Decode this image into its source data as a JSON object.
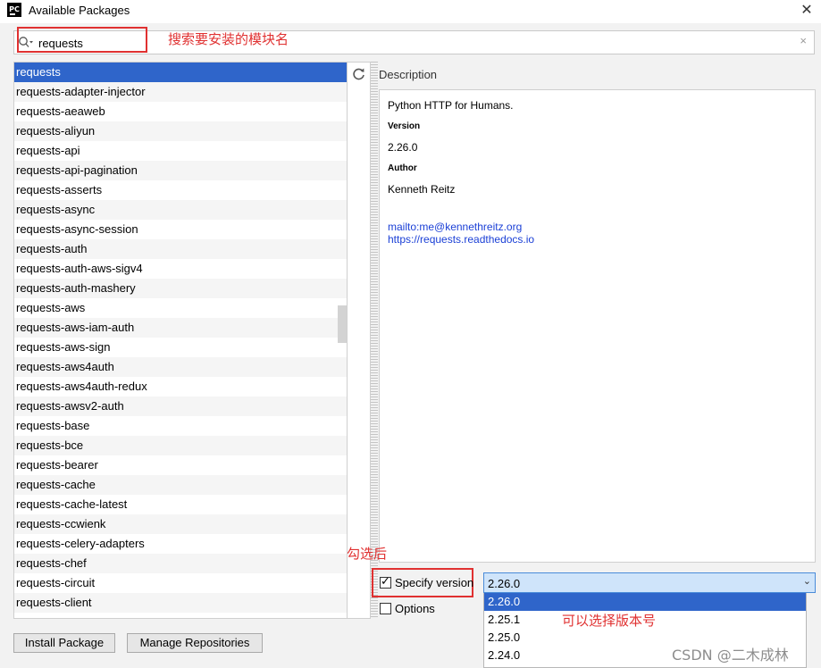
{
  "window": {
    "app_icon_text": "PC",
    "title": "Available Packages",
    "close_glyph": "✕"
  },
  "search": {
    "value": "requests",
    "clear_glyph": "×",
    "annotation": "搜索要安装的模块名"
  },
  "packages": [
    "requests",
    "requests-adapter-injector",
    "requests-aeaweb",
    "requests-aliyun",
    "requests-api",
    "requests-api-pagination",
    "requests-asserts",
    "requests-async",
    "requests-async-session",
    "requests-auth",
    "requests-auth-aws-sigv4",
    "requests-auth-mashery",
    "requests-aws",
    "requests-aws-iam-auth",
    "requests-aws-sign",
    "requests-aws4auth",
    "requests-aws4auth-redux",
    "requests-awsv2-auth",
    "requests-base",
    "requests-bce",
    "requests-bearer",
    "requests-cache",
    "requests-cache-latest",
    "requests-ccwienk",
    "requests-celery-adapters",
    "requests-chef",
    "requests-circuit",
    "requests-client"
  ],
  "selected_package_index": 0,
  "description": {
    "label": "Description",
    "summary": "Python HTTP for Humans.",
    "version_heading": "Version",
    "version": "2.26.0",
    "author_heading": "Author",
    "author": "Kenneth Reitz",
    "links": [
      "mailto:me@kennethreitz.org",
      "https://requests.readthedocs.io"
    ]
  },
  "options": {
    "specify_version_label": "Specify version",
    "specify_version_checked": true,
    "options_label": "Options",
    "options_checked": false,
    "annotation_check": "勾选后",
    "selected_version": "2.26.0",
    "versions": [
      "2.26.0",
      "2.25.1",
      "2.25.0",
      "2.24.0"
    ],
    "annotation_version": "可以选择版本号"
  },
  "buttons": {
    "install": "Install Package",
    "manage": "Manage Repositories"
  },
  "watermark": "CSDN @二木成林",
  "colors": {
    "selection": "#2f65ca",
    "annotation": "#e03131",
    "link": "#1a3fd6",
    "combo_bg": "#cfe4fa"
  }
}
